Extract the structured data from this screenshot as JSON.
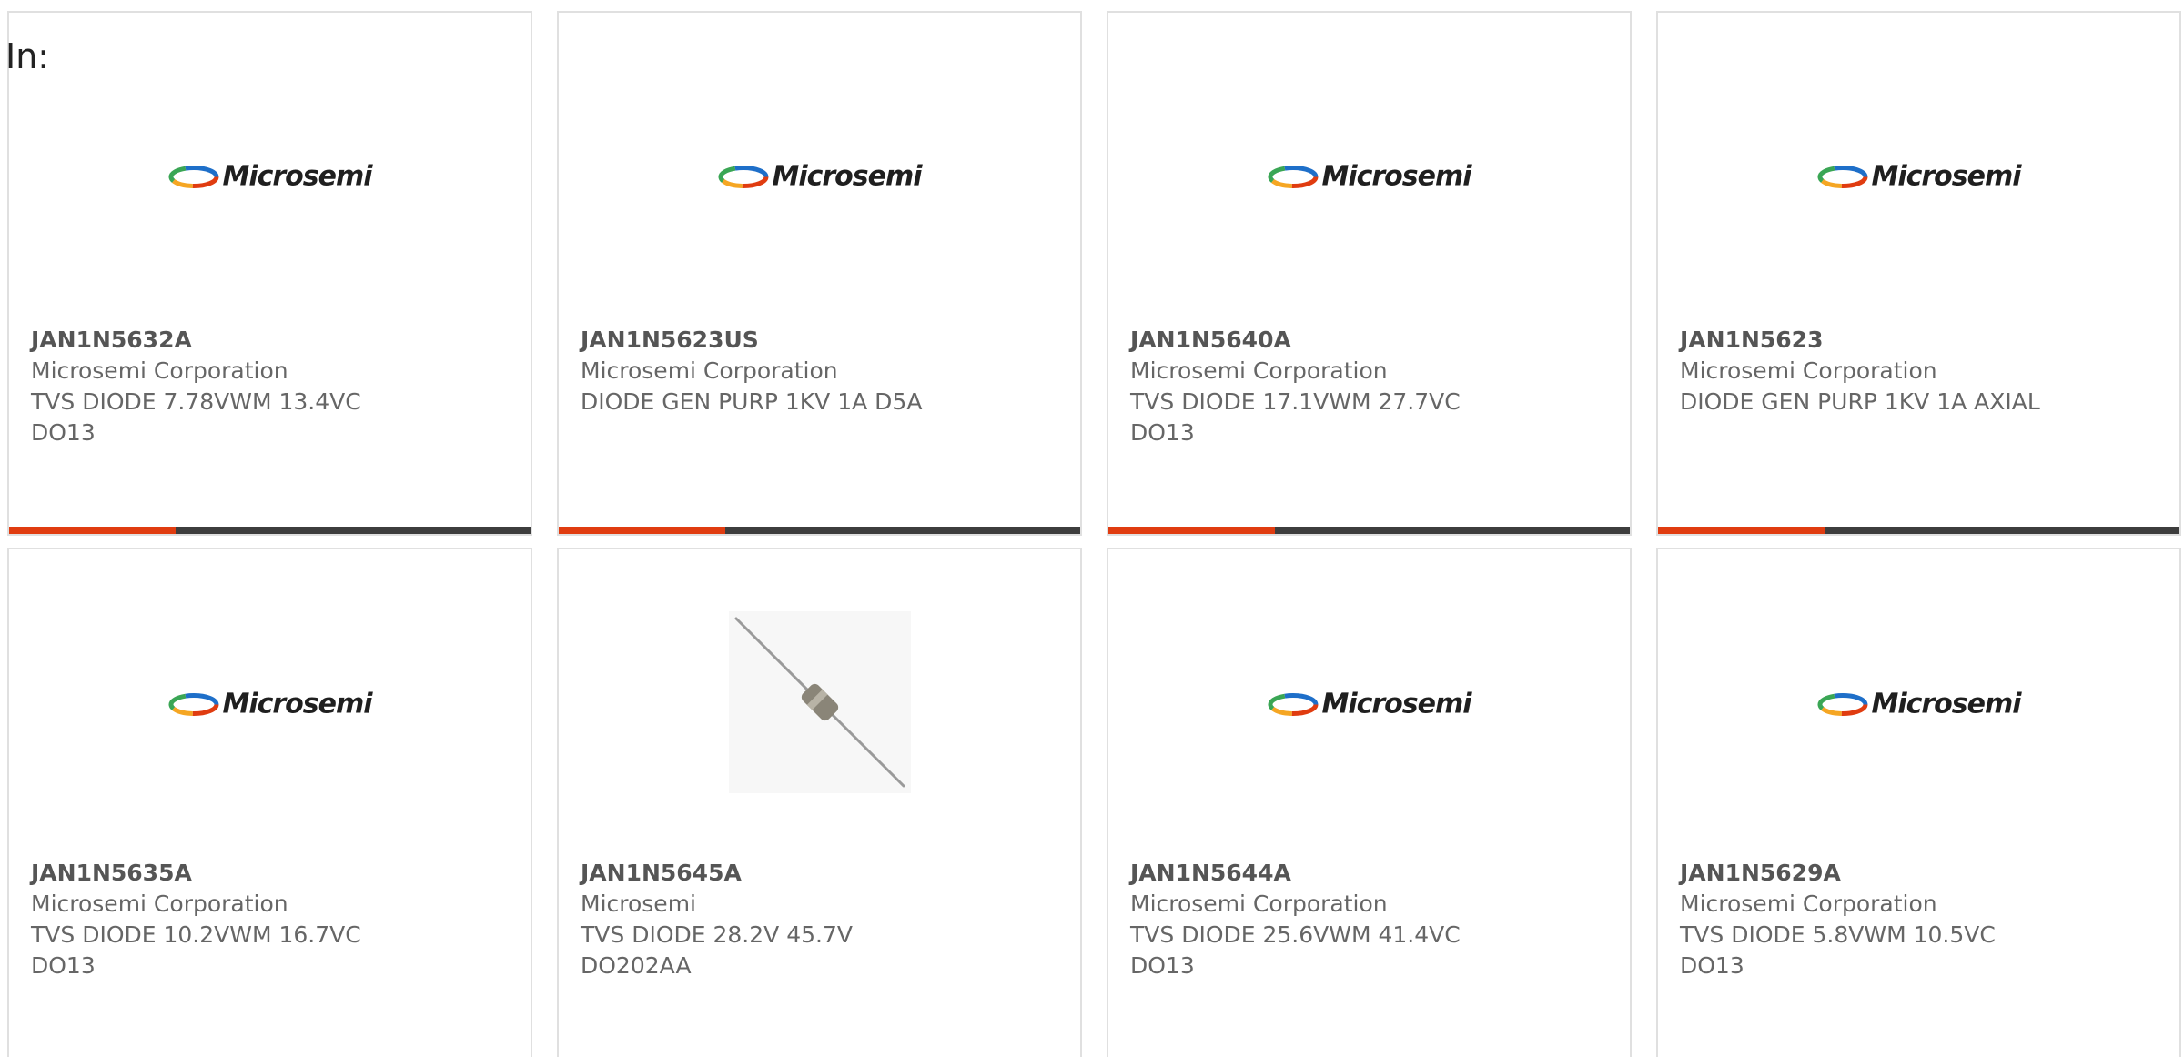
{
  "header": {
    "in_label": "In:"
  },
  "brand": {
    "logo_text": "Microsemi",
    "accent_color": "#e03c10",
    "bar_color": "#3d3d3d"
  },
  "products": [
    {
      "part_number": "JAN1N5632A",
      "manufacturer": "Microsemi Corporation",
      "description_lines": [
        "TVS DIODE 7.78VWM 13.4VC",
        "DO13"
      ],
      "image": "microsemi-logo",
      "has_bar": true
    },
    {
      "part_number": "JAN1N5623US",
      "manufacturer": "Microsemi Corporation",
      "description_lines": [
        "DIODE GEN PURP 1KV 1A D5A",
        ""
      ],
      "image": "microsemi-logo",
      "has_bar": true
    },
    {
      "part_number": "JAN1N5640A",
      "manufacturer": "Microsemi Corporation",
      "description_lines": [
        "TVS DIODE 17.1VWM 27.7VC",
        "DO13"
      ],
      "image": "microsemi-logo",
      "has_bar": true
    },
    {
      "part_number": "JAN1N5623",
      "manufacturer": "Microsemi Corporation",
      "description_lines": [
        "DIODE GEN PURP 1KV 1A AXIAL",
        ""
      ],
      "image": "microsemi-logo",
      "has_bar": true
    },
    {
      "part_number": "JAN1N5635A",
      "manufacturer": "Microsemi Corporation",
      "description_lines": [
        "TVS DIODE 10.2VWM 16.7VC",
        "DO13"
      ],
      "image": "microsemi-logo",
      "has_bar": false
    },
    {
      "part_number": "JAN1N5645A",
      "manufacturer": "Microsemi",
      "description_lines": [
        "TVS DIODE 28.2V 45.7V",
        "DO202AA"
      ],
      "image": "axial-diode-photo",
      "has_bar": false
    },
    {
      "part_number": "JAN1N5644A",
      "manufacturer": "Microsemi Corporation",
      "description_lines": [
        "TVS DIODE 25.6VWM 41.4VC",
        "DO13"
      ],
      "image": "microsemi-logo",
      "has_bar": false
    },
    {
      "part_number": "JAN1N5629A",
      "manufacturer": "Microsemi Corporation",
      "description_lines": [
        "TVS DIODE 5.8VWM 10.5VC",
        "DO13"
      ],
      "image": "microsemi-logo",
      "has_bar": false
    }
  ]
}
